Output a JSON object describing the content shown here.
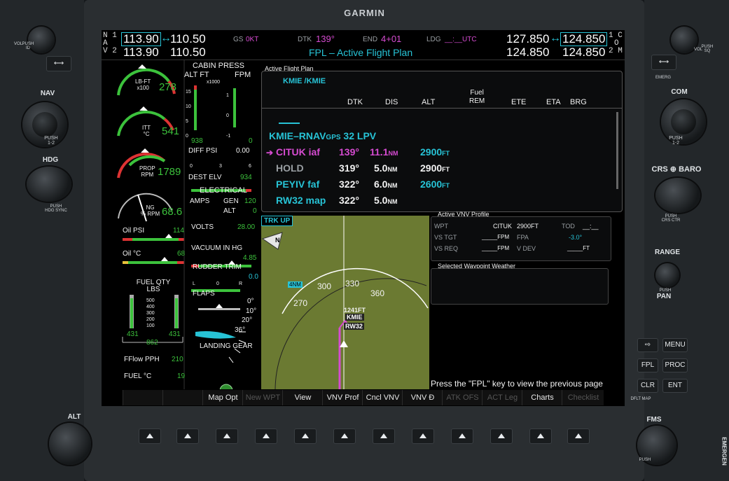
{
  "brand": "GARMIN",
  "left_panel": {
    "vol_label": "VOL",
    "push_id": "PUSH\nID",
    "nav_label": "NAV",
    "push_12_nav": "PUSH\n1-2",
    "hdg_label": "HDG",
    "push_hdg_sync": "PUSH\nHDG SYNC",
    "alt_label": "ALT",
    "swap_icon": "left-right-arrow-icon"
  },
  "right_panel": {
    "vol_label": "VOL",
    "push_sq": "PUSH\nSQ",
    "emerg": "EMERG",
    "com_label": "COM",
    "push_12_com": "PUSH\n1-2",
    "crs_baro_label": "CRS ⊕ BARO",
    "push_crs_ctr": "PUSH\nCRS CTR",
    "range_label": "RANGE",
    "push_pan": "PUSH",
    "pan_label": "PAN",
    "menu_label": "MENU",
    "fpl_label": "FPL",
    "proc_label": "PROC",
    "clr_label": "CLR",
    "ent_label": "ENT",
    "dflt_map": "DFLT MAP",
    "fms_label": "FMS",
    "push_label": "PUSH",
    "emergency_label": "EMERGEN"
  },
  "topbar": {
    "nav_side_1": "N 1",
    "nav_side_2": "A",
    "nav_side_3": "V 2",
    "nav1_active": "113.90",
    "nav1_arrow": "↔",
    "nav1_standby": "110.50",
    "nav2_active": "113.90",
    "nav2_standby": "110.50",
    "gs_label": "GS",
    "gs_value": "0KT",
    "dtk_label": "DTK",
    "dtk_value": "139°",
    "end_label": "END",
    "end_value": "4+01",
    "ldg_label": "LDG",
    "ldg_value": "__:__UTC",
    "page_title": "FPL – Active Flight Plan",
    "com1_standby": "127.850",
    "com_arrow": "↔",
    "com1_active": "124.850",
    "com2_standby": "124.850",
    "com2_active": "124.850",
    "com_side_1": "1 C",
    "com_side_2": "O",
    "com_side_3": "2 M"
  },
  "eis": {
    "lbft_label": "LB-FT\nx100",
    "lbft_value": "278",
    "itt_label": "ITT\n°C",
    "itt_value": "541",
    "prop_label": "PROP\nRPM",
    "prop_value": "1789",
    "ng_label": "NG\n% RPM",
    "ng_value": "68.6",
    "oil_psi_label": "Oil PSI",
    "oil_psi_value": "114",
    "oil_c_label": "Oil °C",
    "oil_c_value": "68",
    "fuel_qty_label": "FUEL QTY\nLBS",
    "fuel_scale": [
      "500",
      "400",
      "300",
      "200",
      "100"
    ],
    "fuel_left": "431",
    "fuel_right": "431",
    "fuel_total": "862",
    "fflow_label": "FFlow PPH",
    "fflow_value": "210",
    "fuel_c_label": "FUEL °C",
    "fuel_c_value": "19",
    "cabin_press": "CABIN PRESS",
    "alt_ft": "ALT FT",
    "x1000": "x1000",
    "fpm": "FPM",
    "cabin_scale_left": [
      "15",
      "10",
      "5",
      "0"
    ],
    "cabin_scale_right": [
      "1",
      "0",
      "-1"
    ],
    "cabin_alt_value": "938",
    "cabin_rate_value": "0",
    "diff_psi_label": "DIFF PSI",
    "diff_psi_value": "0.00",
    "diff_scale": [
      "0",
      "3",
      "6"
    ],
    "dest_elv_label": "DEST ELV",
    "dest_elv_value": "934",
    "electrical": "ELECTRICAL",
    "amps": "AMPS",
    "gen": "GEN",
    "gen_value": "120",
    "alt": "ALT",
    "alt_value": "0",
    "volts_label": "VOLTS",
    "volts_value": "28.00",
    "vacuum_label": "VACUUM IN HG",
    "vacuum_value": "4.85",
    "rudder_trim": "RUDDER TRIM",
    "rudder_value": "0.0",
    "rudder_scale": [
      "L",
      "0",
      "R"
    ],
    "flaps": "FLAPS",
    "flap_marks": [
      "0°",
      "10°",
      "20°",
      "36°"
    ],
    "landing_gear": "LANDING GEAR"
  },
  "fpl": {
    "title": "Active Flight Plan",
    "route": "KMIE /KMIE",
    "columns": [
      "DTK",
      "DIS",
      "ALT",
      "Fuel\nREM",
      "ETE",
      "ETA",
      "BRG"
    ],
    "procedure": "KMIE–RNAV",
    "procedure_gps": "GPS",
    "procedure_rwy": " 32 LPV",
    "rows": [
      {
        "name": "CITUK iaf",
        "dtk": "139°",
        "dis": "11.1",
        "unit": "NM",
        "alt": "2900",
        "alt_unit": "FT",
        "active": true
      },
      {
        "name": "HOLD",
        "dtk": "319°",
        "dis": "5.0",
        "unit": "NM",
        "alt": "2900",
        "alt_unit": "FT",
        "active": false
      },
      {
        "name": "PEYIV faf",
        "dtk": "322°",
        "dis": "6.0",
        "unit": "NM",
        "alt": "2600",
        "alt_unit": "FT",
        "active": false
      },
      {
        "name": "RW32 map",
        "dtk": "322°",
        "dis": "5.0",
        "unit": "NM",
        "alt": "",
        "alt_unit": "",
        "active": false
      }
    ],
    "active_arrow": "➔"
  },
  "map": {
    "trk_up": "TRK UP",
    "range_label": "4NM",
    "compass": [
      "270",
      "300",
      "330",
      "360"
    ],
    "elevation": "1241FT",
    "airport": "KMIE",
    "runway": "RW32",
    "north": "N"
  },
  "vnv": {
    "title": "Active VNV Profile",
    "wpt_label": "WPT",
    "wpt_value": "CITUK",
    "wpt_alt": "2900FT",
    "tod_label": "TOD",
    "tod_value": "__:__",
    "vs_tgt_label": "VS TGT",
    "vs_tgt_value": "_____FPM",
    "fpa_label": "FPA",
    "fpa_value": "-3.0°",
    "vs_req_label": "VS REQ",
    "vs_req_value": "_____FPM",
    "vdev_label": "V DEV",
    "vdev_value": "_____FT"
  },
  "weather": {
    "title": "Selected Waypoint Weather"
  },
  "hint": "Press the \"FPL\" key to view the previous page",
  "softkeys": [
    "",
    "",
    "Map Opt",
    "New WPT",
    "View",
    "VNV Prof",
    "Cncl VNV",
    "VNV Đ",
    "ATK OFS",
    "ACT Leg",
    "Charts",
    "Checklist"
  ],
  "softkeys_dim": [
    false,
    false,
    false,
    true,
    false,
    false,
    false,
    false,
    true,
    true,
    false,
    true
  ]
}
